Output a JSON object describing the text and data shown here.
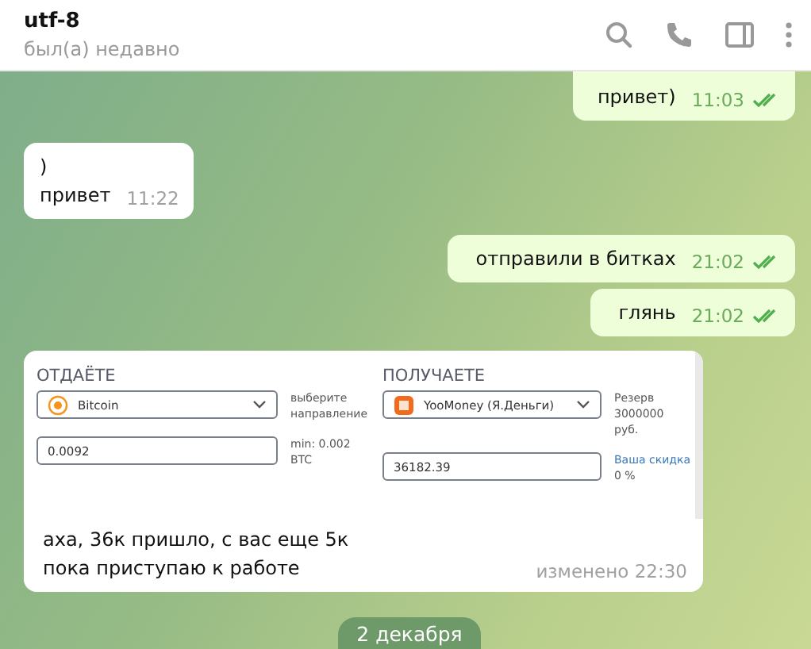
{
  "header": {
    "title": "utf-8",
    "status": "был(а) недавно"
  },
  "messages": [
    {
      "kind": "outgoing",
      "lines": [
        "привет)"
      ],
      "time": "11:03",
      "read": true
    },
    {
      "kind": "incoming",
      "lines": [
        ")",
        "привет"
      ],
      "time": "11:22"
    },
    {
      "kind": "outgoing",
      "lines": [
        "отправили в битках"
      ],
      "time": "21:02",
      "read": true
    },
    {
      "kind": "outgoing",
      "lines": [
        "глянь"
      ],
      "time": "21:02",
      "read": true
    },
    {
      "kind": "screenshot",
      "shot": {
        "give": {
          "label": "ОТДАЁТЕ",
          "currency": "Bitcoin",
          "hint": "выберите направление",
          "amount": "0.0092",
          "note": "min: 0.002 BTC"
        },
        "get": {
          "label": "ПОЛУЧАЕТЕ",
          "currency": "YooMoney (Я.Деньги)",
          "hint": "Резерв 3000000 руб.",
          "amount": "36182.39",
          "link": "Ваша скидка",
          "note": "0 %"
        }
      },
      "lines": [
        "аха, 36к пришло, с вас еще 5к",
        "пока приступаю к работе"
      ],
      "time": "изменено 22:30"
    }
  ],
  "date_pill": "2 декабря"
}
